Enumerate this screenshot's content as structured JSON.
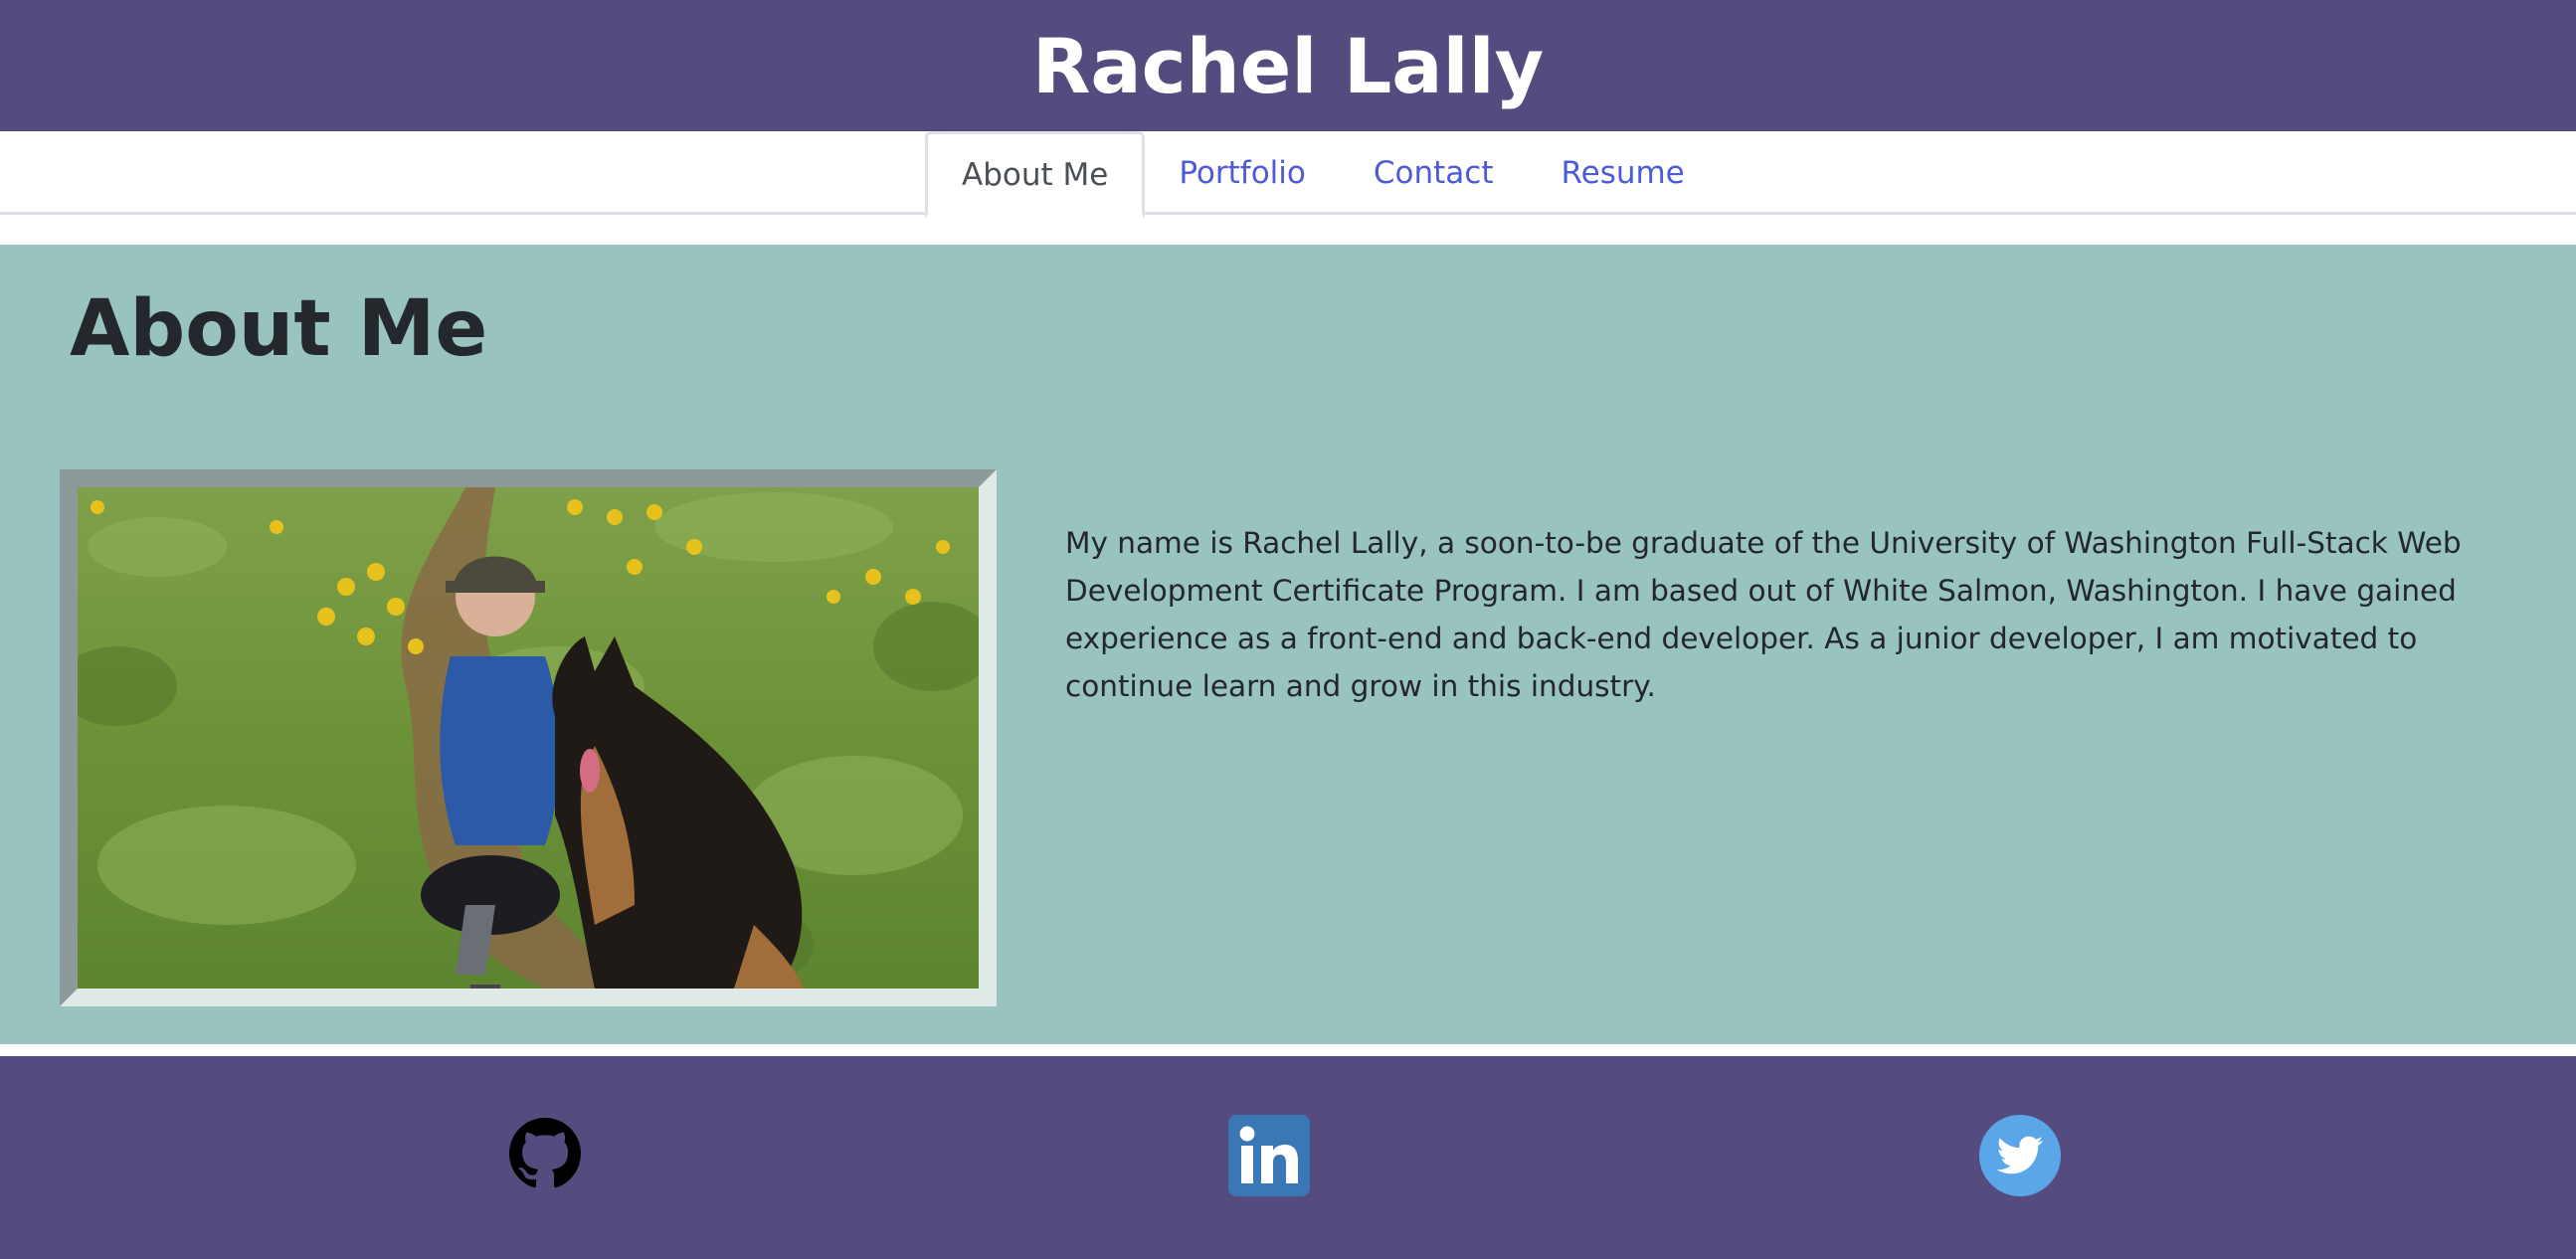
{
  "header": {
    "title": "Rachel Lally"
  },
  "nav": {
    "tabs": [
      {
        "label": "About Me",
        "active": true
      },
      {
        "label": "Portfolio",
        "active": false
      },
      {
        "label": "Contact",
        "active": false
      },
      {
        "label": "Resume",
        "active": false
      }
    ]
  },
  "about": {
    "heading": "About Me",
    "photo_icon": "profile-photo",
    "bio": "My name is Rachel Lally, a soon-to-be graduate of the University of Washington Full-Stack Web Development Certificate Program. I am based out of White Salmon, Washington. I have gained experience as a front-end and back-end developer. As a junior developer, I am motivated to continue learn and grow in this industry."
  },
  "footer": {
    "links": [
      {
        "icon": "github-icon"
      },
      {
        "icon": "linkedin-icon"
      },
      {
        "icon": "twitter-icon"
      }
    ]
  },
  "colors": {
    "header_bg": "#554b7e",
    "section_bg": "#99c3bf",
    "link": "#4d5bd8",
    "text": "#23272b"
  }
}
